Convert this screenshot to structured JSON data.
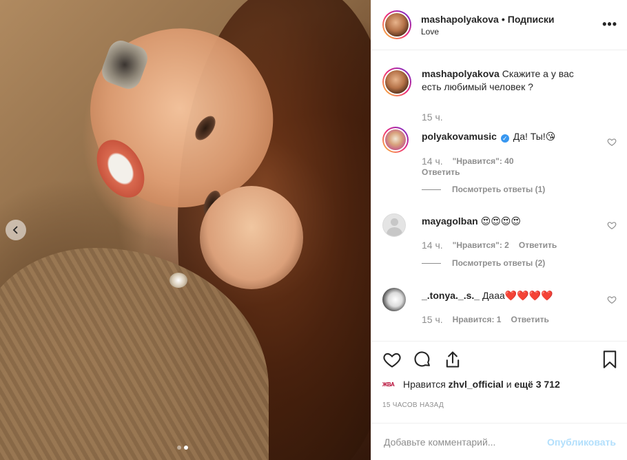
{
  "header": {
    "username": "mashapolyakova",
    "separator": "•",
    "follow_label": "Подписки",
    "location": "Love",
    "more_icon": "more-horizontal-icon"
  },
  "caption": {
    "username": "mashapolyakova",
    "text": "Скажите а у вас есть любимый человек ?",
    "time": "15 ч."
  },
  "comments": [
    {
      "username": "polyakovamusic",
      "verified": true,
      "text": "Да! Ты!😘",
      "time": "14 ч.",
      "likes": "\"Нравится\": 40",
      "reply_label": "Ответить",
      "view_replies": "Посмотреть ответы (1)"
    },
    {
      "username": "mayagolban",
      "text": "😍😍😍😍",
      "time": "14 ч.",
      "likes": "\"Нравится\": 2",
      "reply_label": "Ответить",
      "view_replies": "Посмотреть ответы (2)"
    },
    {
      "username": "_.tonya._.s._",
      "text": "Дааа❤️❤️❤️❤️",
      "time": "15 ч.",
      "likes": "Нравится: 1",
      "reply_label": "Ответить"
    }
  ],
  "actions": {
    "icons": [
      "heart-icon",
      "comment-icon",
      "share-icon",
      "bookmark-icon"
    ]
  },
  "likes_line": {
    "badge": "ЖВА",
    "prefix": "Нравится",
    "user": "zhvl_official",
    "middle": "и",
    "rest": "ещё 3 712"
  },
  "time_ago": "15 ЧАСОВ НАЗАД",
  "add_comment": {
    "placeholder": "Добавьте комментарий...",
    "post_label": "Опубликовать"
  },
  "carousel": {
    "current": 2,
    "total": 2
  },
  "colors": {
    "text": "#262626",
    "muted": "#8e8e8e",
    "verified": "#3897f0",
    "post_disabled": "#b2dffc"
  }
}
